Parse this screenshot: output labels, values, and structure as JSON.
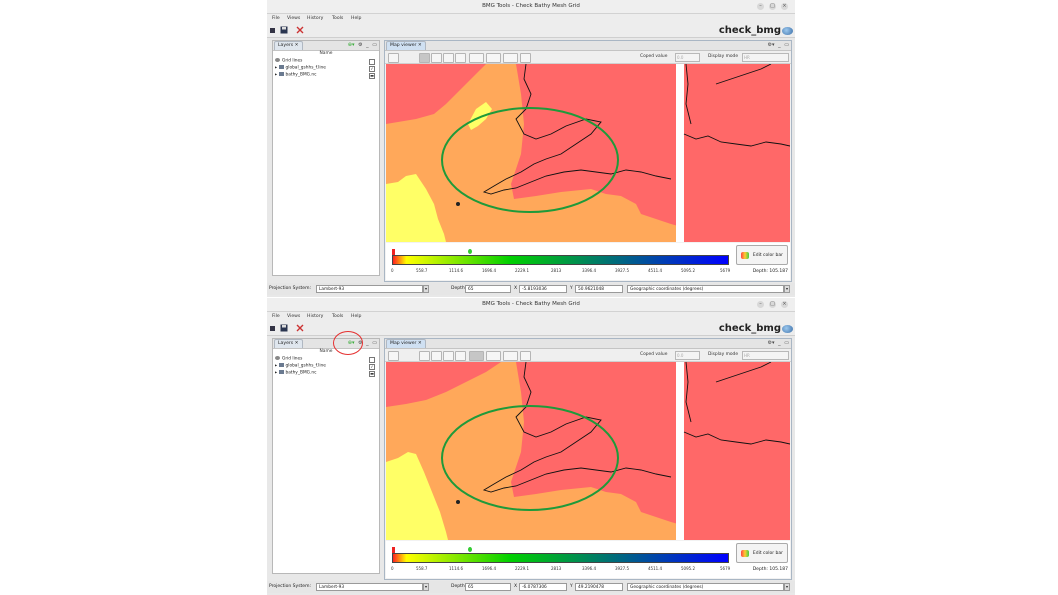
{
  "title": "BMG Tools - Check Bathy Mesh Grid",
  "menu": [
    "File",
    "Views",
    "History",
    "Tools",
    "Help"
  ],
  "brand": "check_bmg",
  "layers_panel": {
    "tab_label": "Layers",
    "column_header": "Name",
    "items": [
      {
        "label": "Grid lines",
        "checked": false
      },
      {
        "label": "global_gshhs_f.line",
        "checked": true
      },
      {
        "label": "bathy_BMG.nc",
        "checked": true
      }
    ]
  },
  "map_viewer": {
    "tab_label": "Map viewer",
    "coped_value_label": "Coped value",
    "coped_value": "0.0",
    "display_mode_label": "Display mode",
    "display_mode": "HR"
  },
  "colorbar": {
    "ticks": [
      "0",
      "558.7",
      "1114.6",
      "1696.4",
      "2229.1",
      "2813",
      "3396.4",
      "3927.5",
      "4511.4",
      "5095.2",
      "5679"
    ],
    "edit_button": "Edit color bar",
    "depth_label": "Depth:",
    "depth_value": "105.187",
    "colors": [
      "#ff2020",
      "#ffff00",
      "#00d000",
      "#0000ff"
    ]
  },
  "statusbar": {
    "projection_label": "Projection System:",
    "projection_value": "Lambert-93",
    "depth_label": "Depth",
    "depth_value": "65",
    "x_label": "X",
    "y_label": "Y",
    "coord_mode": "Geographic coordinates (degrees)"
  },
  "screens": [
    {
      "x_value": "-5.8193036",
      "y_value": "50.9621048"
    },
    {
      "x_value": "-6.0787306",
      "y_value": "49.2190478"
    }
  ],
  "map_colors": {
    "deep": "#ff6868",
    "mid": "#ffa85a",
    "shallow": "#ffff66"
  }
}
